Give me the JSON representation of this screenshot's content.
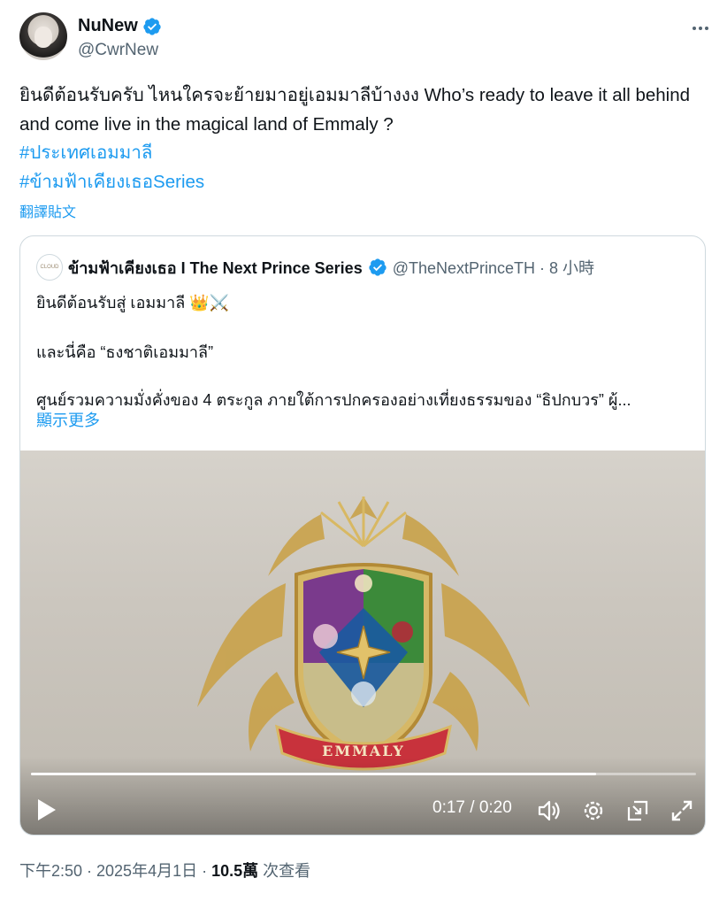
{
  "author": {
    "display_name": "NuNew",
    "handle": "@CwrNew"
  },
  "tweet": {
    "text": "ยินดีต้อนรับครับ ไหนใครจะย้ายมาอยู่เอมมาลีบ้างงง Who’s ready to leave it all behind and come live in the magical land of Emmaly ?",
    "hashtags": [
      "#ประเทศเอมมาลี",
      "#ข้ามฟ้าเคียงเธอSeries"
    ],
    "translate_label": "翻譯貼文"
  },
  "quote": {
    "display_name": "ข้ามฟ้าเคียงเธอ I The Next Prince Series",
    "handle_time": "@TheNextPrinceTH · 8 小時",
    "logo_text": "CLOUD",
    "lines": [
      "ยินดีต้อนรับสู่ เอมมาลี 👑⚔️",
      "และนี่คือ “ธงชาติเอมมาลี”",
      "ศูนย์รวมความมั่งคั่งของ 4 ตระกูล ภายใต้การปกครองอย่างเที่ยงธรรมของ “ธิปกบวร” ผู้..."
    ],
    "show_more": "顯示更多",
    "video": {
      "time": "0:17 / 0:20",
      "progress": 0.85,
      "banner_text": "EMMALY",
      "colors": {
        "purple": "#7a3a8c",
        "green": "#3c8a3a",
        "blue": "#1a5aa0",
        "gold": "#c9a24a",
        "ribbon": "#c8323c"
      }
    }
  },
  "meta": {
    "time_date": "下午2:50 · 2025年4月1日 · ",
    "views": "10.5萬",
    "views_label": " 次查看"
  },
  "icons": [
    "verified-badge-icon",
    "more-icon",
    "play-icon",
    "volume-icon",
    "settings-icon",
    "pip-icon",
    "fullscreen-icon"
  ],
  "colors": {
    "link": "#1d9bf0",
    "muted": "#536471",
    "verified": "#1d9bf0"
  }
}
